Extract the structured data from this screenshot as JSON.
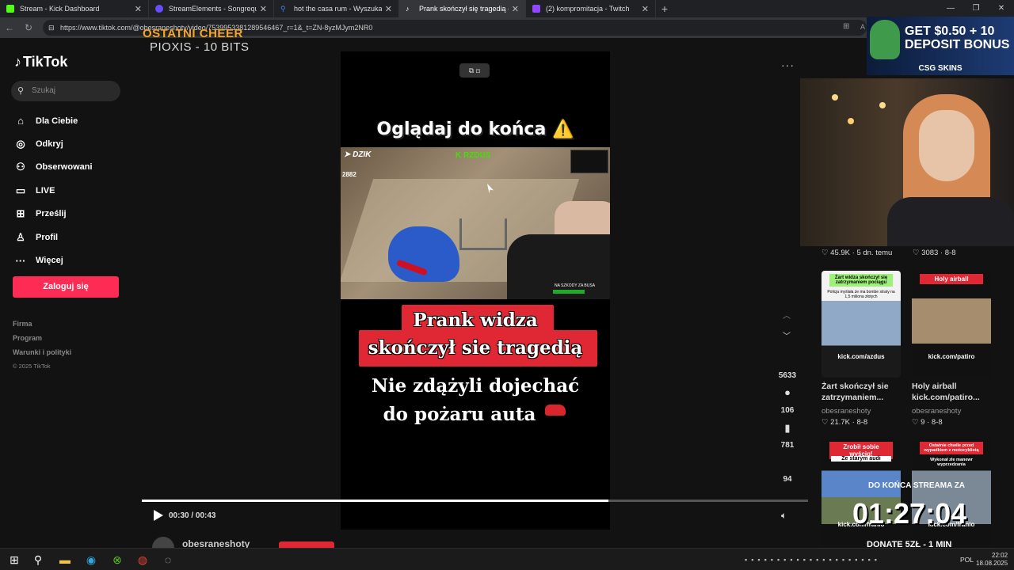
{
  "browser": {
    "tabs": [
      {
        "label": "Stream - Kick Dashboard",
        "color": "#53fc18"
      },
      {
        "label": "StreamElements - Songrequest",
        "color": "#6a4cff"
      },
      {
        "label": "hot the casa rum - Wyszukaj",
        "color": "#3b82f6"
      },
      {
        "label": "Prank skończył się tragedią - Hist",
        "color": "#ffffff"
      },
      {
        "label": "(2) kompromitacja - Twitch",
        "color": "#9146ff"
      }
    ],
    "url": "https://www.tiktok.com/@obesraneshoty/video/7539953381289546467_r=1&_t=ZN-8yzMJym2NR0",
    "addr_tail": "A"
  },
  "overlay": {
    "cheer_title": "OSTATNI CHEER",
    "cheer_sub": "PIOXIS - 10 BITS",
    "ad_text": "GET $0.50 + 10 DEPOSIT BONUS",
    "ad_brand": "CSG SKINS",
    "timer_title": "DO KOŃCA STREAMA ZA",
    "timer": "01:27:04",
    "donate": "DONATE 5ZŁ - 1 MIN"
  },
  "sidebar": {
    "logo": "TikTok",
    "search_placeholder": "Szukaj",
    "nav": [
      {
        "label": "Dla Ciebie",
        "icon": "home-icon",
        "glyph": "⌂"
      },
      {
        "label": "Odkryj",
        "icon": "compass-icon",
        "glyph": "◎"
      },
      {
        "label": "Obserwowani",
        "icon": "user-follow-icon",
        "glyph": "⚇"
      },
      {
        "label": "LIVE",
        "icon": "live-icon",
        "glyph": "▭"
      },
      {
        "label": "Prześlij",
        "icon": "upload-icon",
        "glyph": "⊞"
      },
      {
        "label": "Profil",
        "icon": "profile-icon",
        "glyph": "♙"
      },
      {
        "label": "Więcej",
        "icon": "more-icon",
        "glyph": "···"
      }
    ],
    "login": "Zaloguj się",
    "footer": [
      "Firma",
      "Program",
      "Warunki i polityki"
    ],
    "copyright": "© 2025 TikTok"
  },
  "video": {
    "top_caption": "Oglądaj do końca ⚠️",
    "clip_brand": "DZIK",
    "clip_number": "2882",
    "clip_tag": "K RZDUS",
    "clip_ticker": "NA SZKODY ZA BUSA",
    "headline_1": "Prank widza",
    "headline_2": "skończył sie tragedią",
    "sub_1": "Nie zdążyli dojechać",
    "sub_2": "do pożaru auta",
    "time": "00:30 / 00:43",
    "progress": 0.7,
    "author": "obesraneshoty"
  },
  "actions": {
    "comments": "5633",
    "saves": "106",
    "shares": "781",
    "extra": "94"
  },
  "suggestions": {
    "top_stats": [
      {
        "likes": "45.9K",
        "when": "5 dn. temu"
      },
      {
        "likes": "3083",
        "when": "8-8"
      }
    ],
    "cards": [
      {
        "header": "Żart widza skończył się zatrzymaniem pociągu",
        "caption": "Policja myślała że ma bombe straty na 1,5 miliona złotych",
        "kick": "kick.com/azdus",
        "title_1": "Żart skończył sie",
        "title_2": "zatrzymaniem...",
        "author": "obesraneshoty",
        "likes": "21.7K",
        "when": "8-8"
      },
      {
        "header": "Holy airball",
        "caption": "",
        "kick": "kick.com/patiro",
        "title_1": "Holy airball",
        "title_2": "kick.com/patiro...",
        "author": "obesraneshoty",
        "likes": "9",
        "when": "8-8"
      },
      {
        "header": "Zrobił sobie wyścig!",
        "caption": "Ze starym audi",
        "kick": "kick.com/franio",
        "title_1": "",
        "title_2": "",
        "author": "",
        "likes": "",
        "when": ""
      },
      {
        "header": "Ostatnie chwile przed wypadkiem z motocyklistą",
        "caption": "Wykonał złe manewr wyprzedzania",
        "kick": "kick.com/franio",
        "title_1": "",
        "title_2": "",
        "author": "",
        "likes": "",
        "when": ""
      }
    ]
  },
  "taskbar": {
    "lang": "POL",
    "time": "22:02",
    "date": "18.08.2025"
  }
}
